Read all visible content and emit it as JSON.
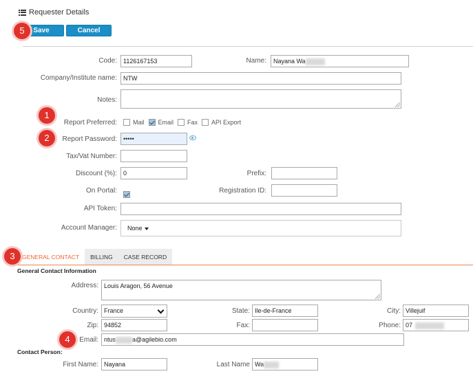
{
  "header": {
    "title": "Requester Details",
    "icon": "list-icon"
  },
  "toolbar": {
    "save_label": "Save",
    "cancel_label": "Cancel"
  },
  "badges": [
    "5",
    "1",
    "2",
    "3",
    "4"
  ],
  "form": {
    "code_label": "Code:",
    "code_value": "1126167153",
    "name_label": "Name:",
    "name_value": "Nayana Wa",
    "company_label": "Company/Institute name:",
    "company_value": "NTW",
    "notes_label": "Notes:",
    "notes_value": "",
    "report_pref_label": "Report Preferred:",
    "report_pref_options": [
      {
        "label": "Mail",
        "checked": false
      },
      {
        "label": "Email",
        "checked": true
      },
      {
        "label": "Fax",
        "checked": false
      },
      {
        "label": "API Export",
        "checked": false
      }
    ],
    "report_password_label": "Report Password:",
    "report_password_value": "•••••",
    "tax_label": "Tax/Vat Number:",
    "tax_value": "",
    "discount_label": "Discount (%):",
    "discount_value": "0",
    "prefix_label": "Prefix:",
    "prefix_value": "",
    "on_portal_label": "On Portal:",
    "on_portal_checked": true,
    "registration_label": "Registration ID:",
    "registration_value": "",
    "api_token_label": "API Token:",
    "api_token_value": "",
    "account_manager_label": "Account Manager:",
    "account_manager_value": "None"
  },
  "tabs": [
    {
      "label": "GENERAL CONTACT",
      "active": true
    },
    {
      "label": "BILLING",
      "active": false
    },
    {
      "label": "CASE RECORD",
      "active": false
    }
  ],
  "contact": {
    "section_title": "General Contact Information",
    "address_label": "Address:",
    "address_value": "Louis Aragon, 56 Avenue",
    "country_label": "Country:",
    "country_value": "France",
    "state_label": "State:",
    "state_value": "Ile-de-France",
    "city_label": "City:",
    "city_value": "Villejuif",
    "zip_label": "Zip:",
    "zip_value": "94852",
    "fax_label": "Fax:",
    "fax_value": "",
    "phone_label": "Phone:",
    "phone_value": "07",
    "email_label": "Email:",
    "email_prefix": "ntus",
    "email_suffix": "a@agilebio.com",
    "person_title": "Contact Person:",
    "first_name_label": "First Name:",
    "first_name_value": "Nayana",
    "last_name_label": "Last Name",
    "last_name_value": "Wa"
  },
  "colors": {
    "primary": "#1b8fc6",
    "badge": "#e0312b",
    "tab_active": "#e8683a",
    "tab_rule": "#e8874f"
  }
}
